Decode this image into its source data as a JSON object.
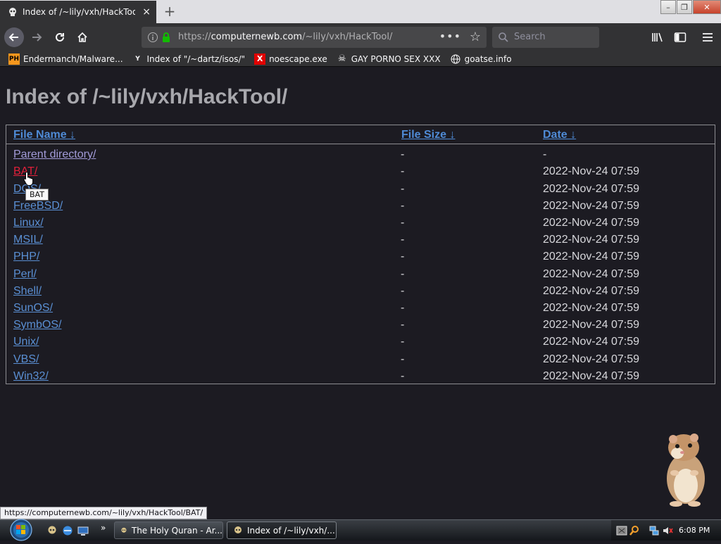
{
  "browser": {
    "tab": {
      "title": "Index of /~lily/vxh/HackTool/",
      "close_glyph": "×"
    },
    "new_tab_glyph": "+",
    "url": {
      "scheme": "https://",
      "host": "computernewb.com",
      "path": "/~lily/vxh/HackTool/"
    },
    "url_more_glyph": "•••",
    "search_placeholder": "Search",
    "window_buttons": {
      "minimize": "–",
      "restore": "❐",
      "close": "✕"
    },
    "bookmarks": [
      {
        "label": "Endermanch/Malware...",
        "icon": "ph-icon",
        "icon_text": "PH"
      },
      {
        "label": "Index of \"/~dartz/isos/\"",
        "icon": "yc-icon",
        "icon_text": "Y"
      },
      {
        "label": "noescape.exe",
        "icon": "x-icon",
        "icon_text": "X"
      },
      {
        "label": "GAY PORNO SEX XXX",
        "icon": "skull-icon",
        "icon_text": "☠"
      },
      {
        "label": "goatse.info",
        "icon": "globe-icon",
        "icon_text": ""
      }
    ]
  },
  "page": {
    "heading": "Index of /~lily/vxh/HackTool/",
    "columns": {
      "name": "File Name ↓",
      "size": "File Size ↓",
      "date": "Date ↓"
    },
    "rows": [
      {
        "name": "Parent directory/",
        "size": "-",
        "date": "-",
        "state": "visited"
      },
      {
        "name": "BAT/",
        "size": "-",
        "date": "2022-Nov-24 07:59",
        "state": "hover"
      },
      {
        "name": "DOS/",
        "size": "-",
        "date": "2022-Nov-24 07:59",
        "state": "link"
      },
      {
        "name": "FreeBSD/",
        "size": "-",
        "date": "2022-Nov-24 07:59",
        "state": "link"
      },
      {
        "name": "Linux/",
        "size": "-",
        "date": "2022-Nov-24 07:59",
        "state": "link"
      },
      {
        "name": "MSIL/",
        "size": "-",
        "date": "2022-Nov-24 07:59",
        "state": "link"
      },
      {
        "name": "PHP/",
        "size": "-",
        "date": "2022-Nov-24 07:59",
        "state": "link"
      },
      {
        "name": "Perl/",
        "size": "-",
        "date": "2022-Nov-24 07:59",
        "state": "link"
      },
      {
        "name": "Shell/",
        "size": "-",
        "date": "2022-Nov-24 07:59",
        "state": "link"
      },
      {
        "name": "SunOS/",
        "size": "-",
        "date": "2022-Nov-24 07:59",
        "state": "link"
      },
      {
        "name": "SymbOS/",
        "size": "-",
        "date": "2022-Nov-24 07:59",
        "state": "link"
      },
      {
        "name": "Unix/",
        "size": "-",
        "date": "2022-Nov-24 07:59",
        "state": "link"
      },
      {
        "name": "VBS/",
        "size": "-",
        "date": "2022-Nov-24 07:59",
        "state": "link"
      },
      {
        "name": "Win32/",
        "size": "-",
        "date": "2022-Nov-24 07:59",
        "state": "link"
      }
    ],
    "tooltip": "BAT",
    "status_url": "https://computernewb.com/~lily/vxh/HackTool/BAT/"
  },
  "taskbar": {
    "buttons": [
      {
        "label": "The Holy Quran - Ar...",
        "active": false
      },
      {
        "label": "Index of /~lily/vxh/...",
        "active": true
      }
    ],
    "overflow_glyph": "»",
    "clock": "6:08 PM"
  },
  "colors": {
    "page_bg": "#1c1b22",
    "heading": "#a8a8ad",
    "link": "#5a8fd3",
    "visited": "#a29bd8",
    "hover": "#e0203a",
    "toolbar": "#323234"
  }
}
